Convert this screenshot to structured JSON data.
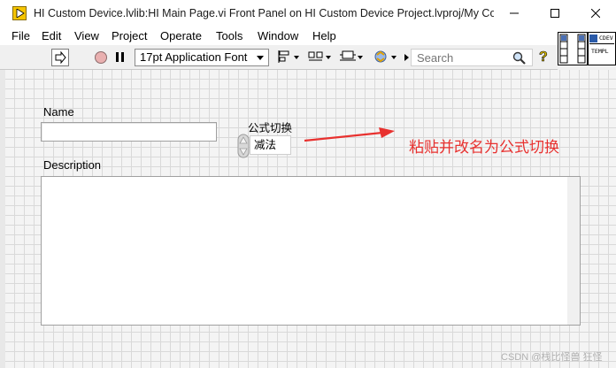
{
  "window": {
    "title": "HI Custom Device.lvlib:HI Main Page.vi Front Panel on HI Custom Device Project.lvproj/My Comp..."
  },
  "menu": [
    "File",
    "Edit",
    "View",
    "Project",
    "Operate",
    "Tools",
    "Window",
    "Help"
  ],
  "toolbar": {
    "font_select": "17pt Application Font",
    "search_placeholder": "Search"
  },
  "vi_icon": {
    "line1": "CDEV",
    "line2": "TEMPL"
  },
  "panel": {
    "name_label": "Name",
    "name_value": "",
    "formula_label": "公式切换",
    "formula_value": "减法",
    "description_label": "Description",
    "description_value": "",
    "annotation": "粘贴并改名为公式切换"
  },
  "watermark": "CSDN @栈比怪兽 狂怪",
  "colors": {
    "annotation_red": "#e8312f",
    "grid_line": "#d9d9d9",
    "panel_bg": "#f4f4f4"
  }
}
